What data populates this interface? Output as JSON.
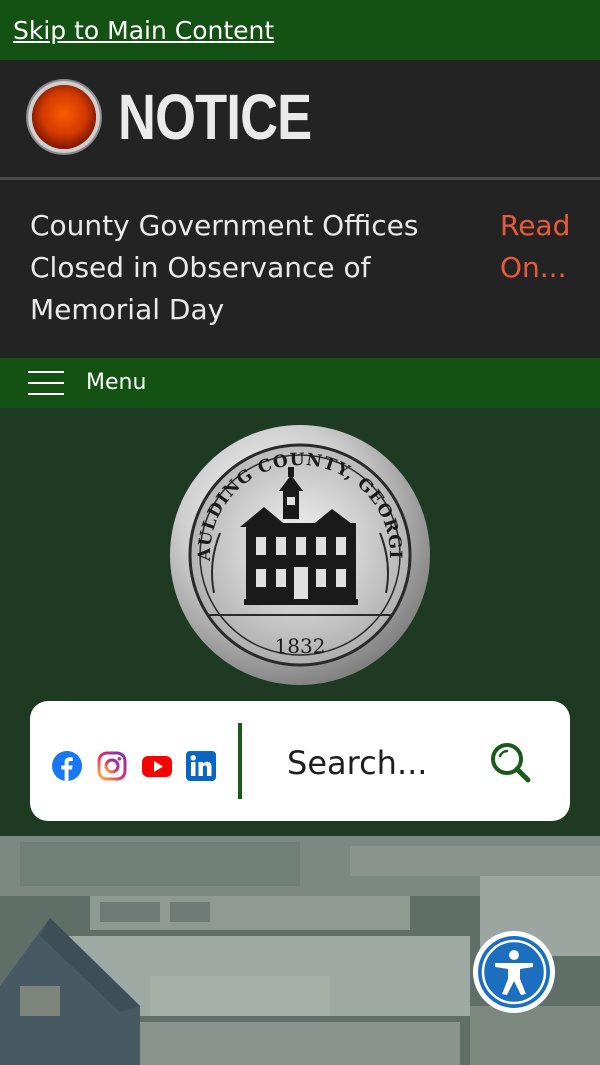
{
  "skip_link": {
    "label": "Skip to Main Content"
  },
  "notice": {
    "title": "NOTICE",
    "message": "County Government Offices Closed in Observance of Memorial Day",
    "read_more": "Read On..."
  },
  "menu": {
    "label": "Menu"
  },
  "seal": {
    "text_top": "PAULDING COUNTY, GEORGIA",
    "year": "1832"
  },
  "social": [
    {
      "name": "facebook",
      "icon": "facebook-icon",
      "color": "#1877f2"
    },
    {
      "name": "instagram",
      "icon": "instagram-icon",
      "color": "#e1306c"
    },
    {
      "name": "youtube",
      "icon": "youtube-icon",
      "color": "#ff0000"
    },
    {
      "name": "linkedin",
      "icon": "linkedin-icon",
      "color": "#0a66c2"
    }
  ],
  "search": {
    "placeholder": "Search...",
    "icon": "search-icon"
  },
  "accessibility": {
    "icon": "accessibility-icon",
    "color": "#1c6fbf"
  },
  "colors": {
    "brand_green": "#145214",
    "notice_bg": "#232323",
    "read_more": "#ea5a3a"
  }
}
